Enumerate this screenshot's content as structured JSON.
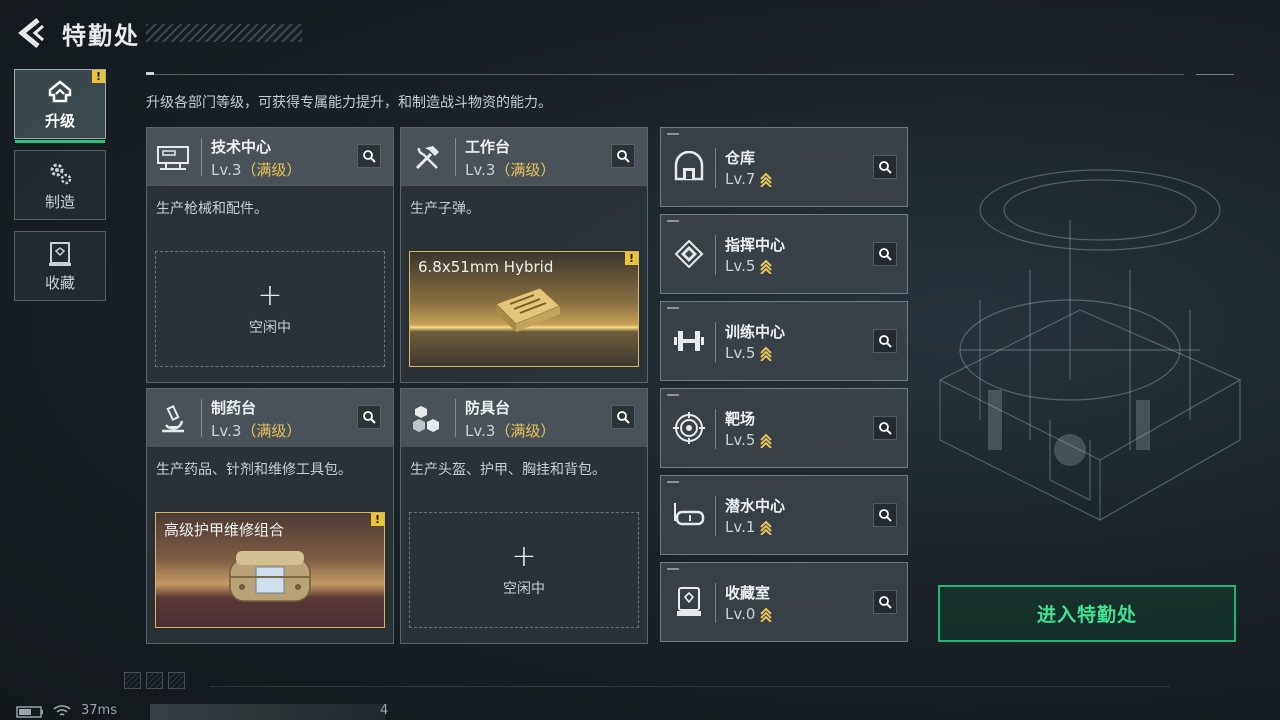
{
  "header": {
    "title": "特勤处",
    "back_icon": "back-arrow-icon"
  },
  "subtitle": "升级各部门等级，可获得专属能力提升，和制造战斗物资的能力。",
  "nav": [
    {
      "label": "升级",
      "icon": "upgrade-icon",
      "active": true,
      "alert": "!"
    },
    {
      "label": "制造",
      "icon": "gears-icon",
      "active": false
    },
    {
      "label": "收藏",
      "icon": "collection-icon",
      "active": false
    }
  ],
  "cards": [
    {
      "name": "技术中心",
      "level": "Lv.3",
      "max_tag": "（满级）",
      "icon": "monitor-icon",
      "desc": "生产枪械和配件。",
      "slot": {
        "state": "idle",
        "plus": "+",
        "label": "空闲中"
      }
    },
    {
      "name": "工作台",
      "level": "Lv.3",
      "max_tag": "（满级）",
      "icon": "tools-icon",
      "desc": "生产子弹。",
      "slot": {
        "state": "producing",
        "item": "6.8x51mm Hybrid",
        "alert": "!"
      }
    },
    {
      "name": "制药台",
      "level": "Lv.3",
      "max_tag": "（满级）",
      "icon": "microscope-icon",
      "desc": "生产药品、针剂和维修工具包。",
      "slot": {
        "state": "producing",
        "item": "高级护甲维修组合",
        "alert": "!"
      }
    },
    {
      "name": "防具台",
      "level": "Lv.3",
      "max_tag": "（满级）",
      "icon": "armor-boxes-icon",
      "desc": "生产头盔、护甲、胸挂和背包。",
      "slot": {
        "state": "idle",
        "plus": "+",
        "label": "空闲中"
      }
    }
  ],
  "facilities": [
    {
      "name": "仓库",
      "level": "Lv.7",
      "icon": "warehouse-icon"
    },
    {
      "name": "指挥中心",
      "level": "Lv.5",
      "icon": "chip-icon"
    },
    {
      "name": "训练中心",
      "level": "Lv.5",
      "icon": "dumbbell-icon"
    },
    {
      "name": "靶场",
      "level": "Lv.5",
      "icon": "target-icon"
    },
    {
      "name": "潜水中心",
      "level": "Lv.1",
      "icon": "diving-mask-icon"
    },
    {
      "name": "收藏室",
      "level": "Lv.0",
      "icon": "collection-room-icon"
    }
  ],
  "enter_button": "进入特勤处",
  "status": {
    "ping": "37ms",
    "page": "4"
  },
  "colors": {
    "accent_green": "#27c37a",
    "gold": "#e6c35a",
    "alert_yellow": "#e9c33a"
  }
}
